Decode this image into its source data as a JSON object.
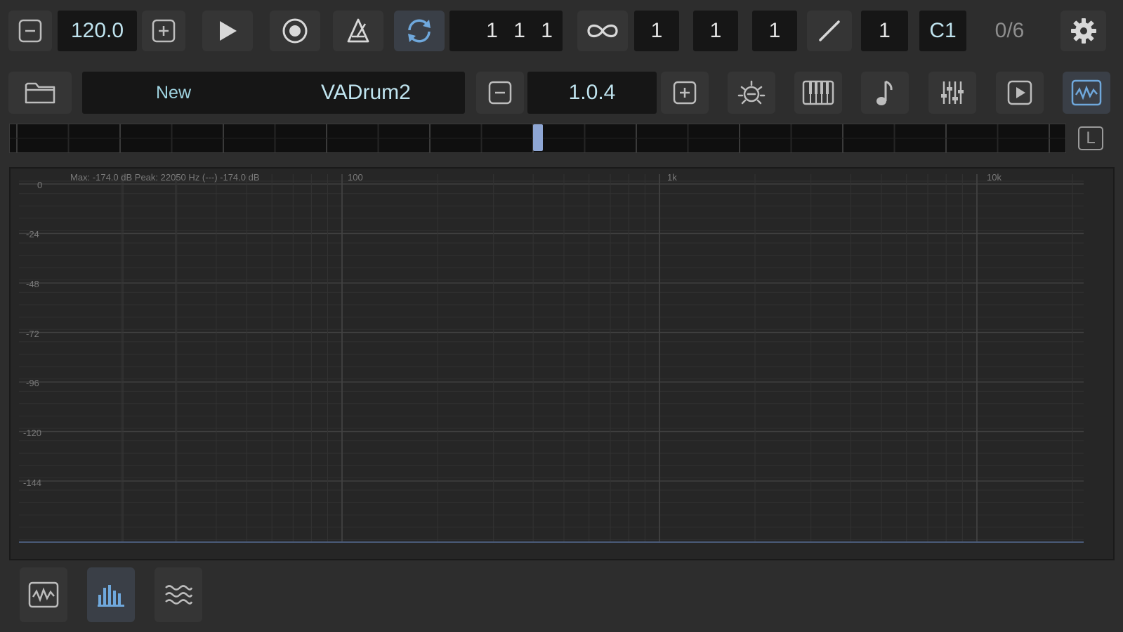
{
  "transport": {
    "tempo": "120.0",
    "position": "1 1 1",
    "loop_start": "1",
    "loop_mid": "1",
    "loop_end": "1",
    "step_value": "1",
    "note_value": "C1",
    "counter": "0/6"
  },
  "project": {
    "name_left": "New",
    "name_right": "VADrum2",
    "version": "1.0.4"
  },
  "scope": {
    "info": "Max: -174.0 dB  Peak: 22050 Hz (---) -174.0 dB",
    "x_labels": [
      "100",
      "1k",
      "10k"
    ],
    "y_labels": [
      "0",
      "-24",
      "-48",
      "-72",
      "-96",
      "-120",
      "-144"
    ]
  },
  "scrubber": {
    "lock_label": "L"
  },
  "icons": {
    "minus": "minus-box-icon",
    "plus": "plus-box-icon",
    "play": "play-icon",
    "record": "record-icon",
    "metronome": "metronome-icon",
    "loop": "loop-icon",
    "infinity": "infinity-icon",
    "slash": "slash-icon",
    "gear": "gear-icon",
    "folder": "folder-icon"
  },
  "colors": {
    "accent": "#6fa8dc",
    "teal_text": "#9fd3e0",
    "background": "#2d2d2d",
    "field": "#161616"
  }
}
